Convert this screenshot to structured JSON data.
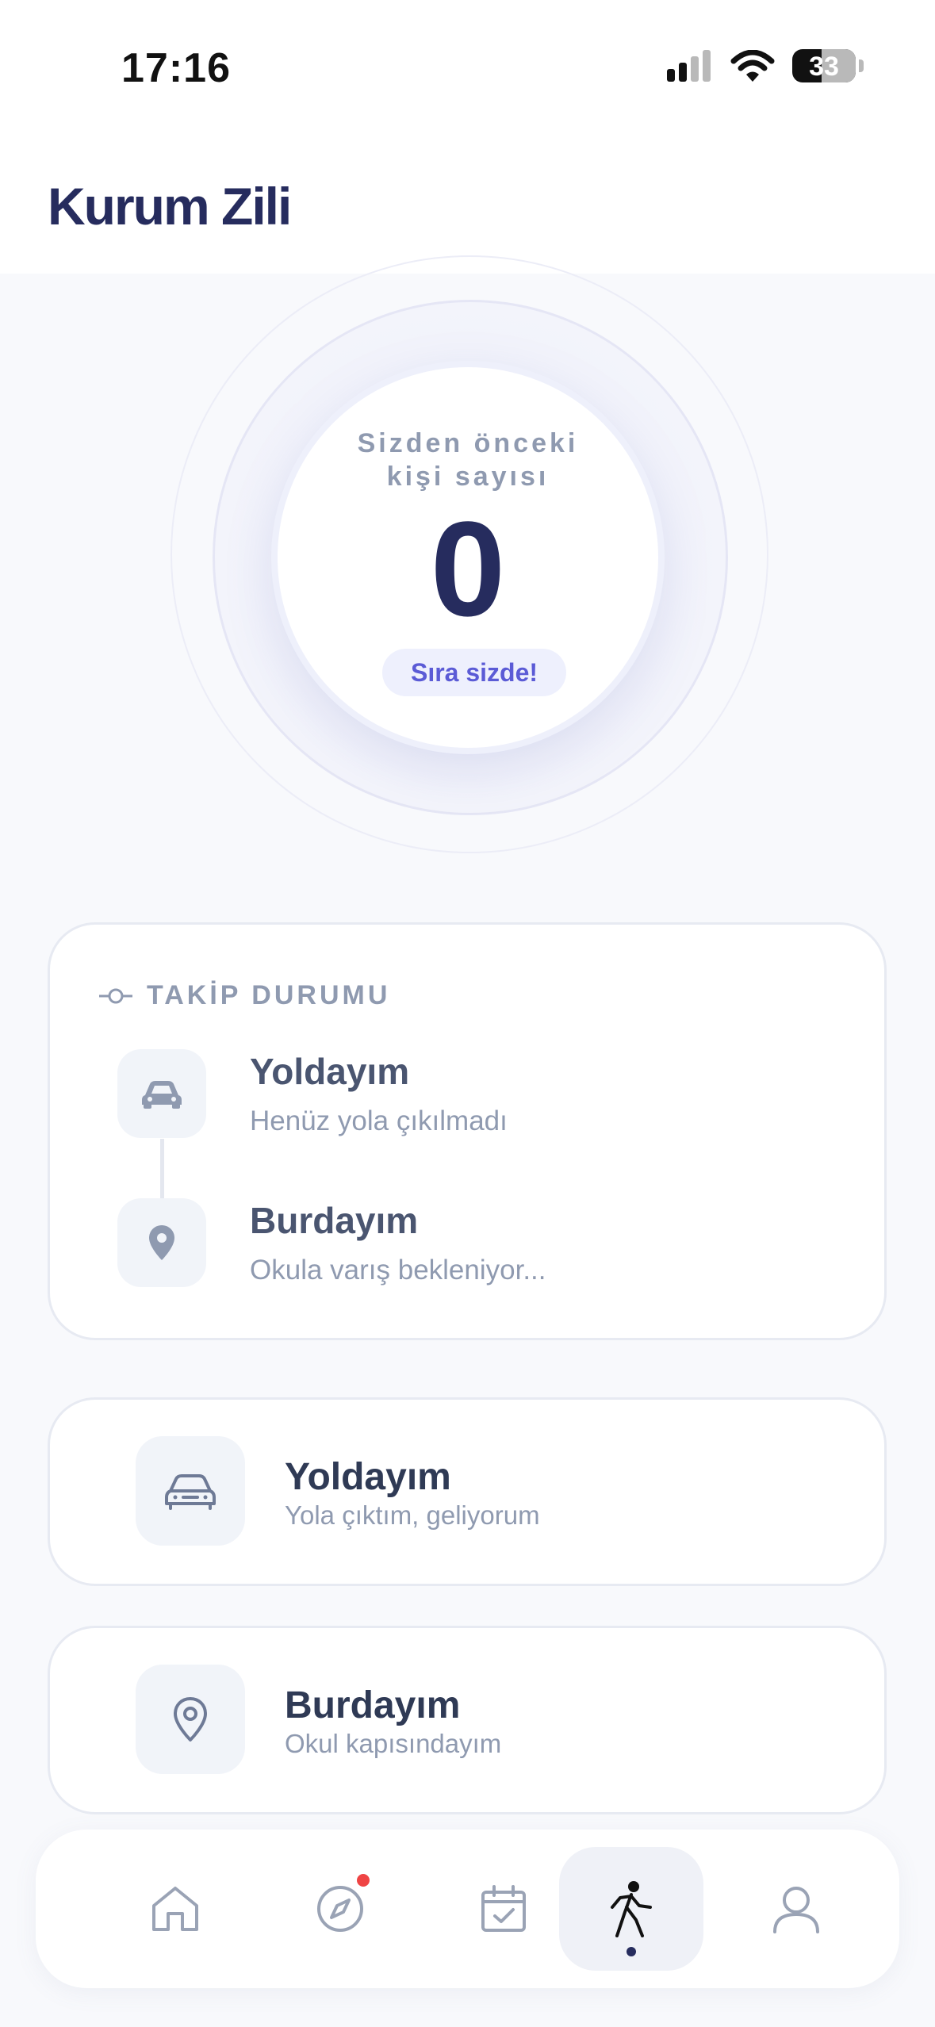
{
  "status_bar": {
    "time": "17:16",
    "battery": "33"
  },
  "header": {
    "title": "Kurum Zili"
  },
  "queue": {
    "label": "Sizden önceki kişi sayısı",
    "count": "0",
    "status": "Sıra sizde!"
  },
  "tracking": {
    "title": "TAKİP DURUMU",
    "steps": [
      {
        "title": "Yoldayım",
        "subtitle": "Henüz yola çıkılmadı",
        "icon": "car-icon"
      },
      {
        "title": "Burdayım",
        "subtitle": "Okula varış bekleniyor...",
        "icon": "map-pin-icon"
      }
    ]
  },
  "actions": [
    {
      "title": "Yoldayım",
      "subtitle": "Yola çıktım, geliyorum",
      "icon": "car-icon"
    },
    {
      "title": "Burdayım",
      "subtitle": "Okul kapısındayım",
      "icon": "map-pin-icon"
    }
  ],
  "tab_bar": {
    "items": [
      {
        "icon": "home-icon",
        "active": false,
        "badge": false
      },
      {
        "icon": "compass-icon",
        "active": false,
        "badge": true
      },
      {
        "icon": "calendar-check-icon",
        "active": false,
        "badge": false
      },
      {
        "icon": "walking-person-icon",
        "active": true,
        "badge": false
      },
      {
        "icon": "user-icon",
        "active": false,
        "badge": false
      }
    ]
  },
  "colors": {
    "brand": "#262c5e",
    "accent": "#5b5bd6",
    "muted": "#8f9ab0",
    "badge": "#ef4444"
  }
}
